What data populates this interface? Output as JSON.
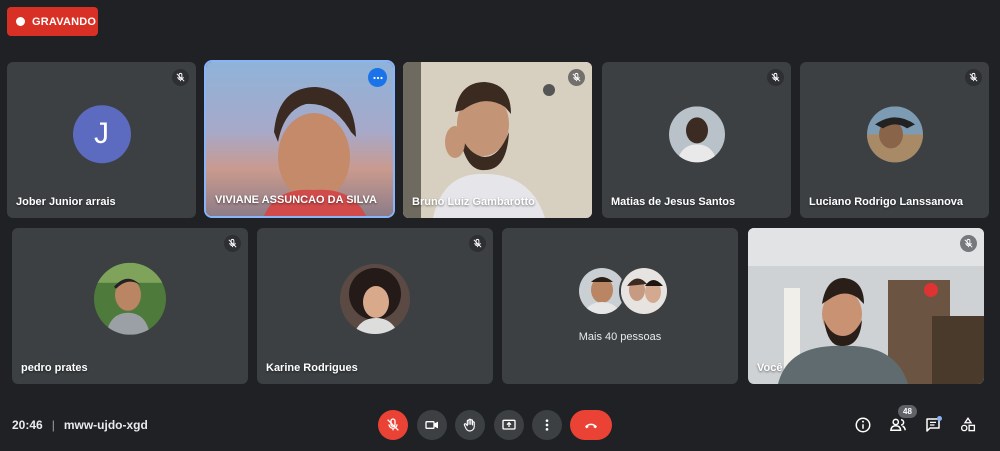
{
  "recording": {
    "label": "GRAVANDO"
  },
  "participants": [
    {
      "name": "Jober Junior arrais",
      "initial": "J"
    },
    {
      "name": "VIVIANE ASSUNCAO DA SILVA"
    },
    {
      "name": "Bruno Luiz Gambarotto"
    },
    {
      "name": "Matias de Jesus Santos"
    },
    {
      "name": "Luciano Rodrigo Lanssanova"
    },
    {
      "name": "pedro prates"
    },
    {
      "name": "Karine Rodrigues"
    },
    {
      "name": "Você"
    }
  ],
  "more_people": {
    "label": "Mais 40 pessoas"
  },
  "meeting": {
    "time": "20:46",
    "code": "mww-ujdo-xgd"
  },
  "people_count": "48",
  "colors": {
    "background": "#202124",
    "tile": "#3c4043",
    "danger": "#ea4335",
    "accent": "#1a73e8"
  }
}
